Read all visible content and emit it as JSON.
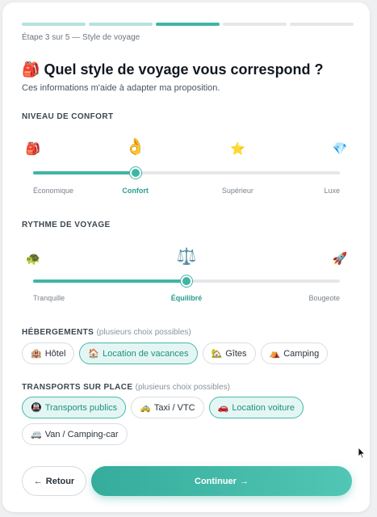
{
  "progress": {
    "current": 3,
    "total": 5
  },
  "step_label": "Étape 3 sur 5 — Style de voyage",
  "title_icon": "🎒",
  "title": "Quel style de voyage vous correspond ?",
  "subtitle": "Ces informations m'aide à adapter ma proposition.",
  "comfort": {
    "title": "NIVEAU DE CONFORT",
    "selected_index": 1,
    "options": [
      {
        "icon": "🎒",
        "label": "Économique"
      },
      {
        "icon": "👌",
        "label": "Confort"
      },
      {
        "icon": "⭐",
        "label": "Supérieur"
      },
      {
        "icon": "💎",
        "label": "Luxe"
      }
    ]
  },
  "rhythm": {
    "title": "RYTHME DE VOYAGE",
    "selected_index": 1,
    "options": [
      {
        "icon": "🐢",
        "label": "Tranquille"
      },
      {
        "icon": "⚖️",
        "label": "Équilibré"
      },
      {
        "icon": "🚀",
        "label": "Bougeote"
      }
    ]
  },
  "accommodations": {
    "title": "HÉBERGEMENTS",
    "hint": "(plusieurs choix possibles)",
    "chips": [
      {
        "icon": "🏨",
        "label": "Hôtel",
        "selected": false
      },
      {
        "icon": "🏠",
        "label": "Location de vacances",
        "selected": true
      },
      {
        "icon": "🏡",
        "label": "Gîtes",
        "selected": false
      },
      {
        "icon": "⛺",
        "label": "Camping",
        "selected": false
      }
    ]
  },
  "transports": {
    "title": "TRANSPORTS SUR PLACE",
    "hint": "(plusieurs choix possibles)",
    "chips": [
      {
        "icon": "🚇",
        "label": "Transports publics",
        "selected": true
      },
      {
        "icon": "🚕",
        "label": "Taxi / VTC",
        "selected": false
      },
      {
        "icon": "🚗",
        "label": "Location voiture",
        "selected": true
      },
      {
        "icon": "🚐",
        "label": "Van / Camping-car",
        "selected": false
      }
    ]
  },
  "buttons": {
    "back_arrow": "←",
    "back_label": "Retour",
    "next_label": "Continuer",
    "next_arrow": "→"
  },
  "colors": {
    "accent": "#3fb5a5",
    "accent_light": "#b6e2dc",
    "chip_selected_bg": "#e4f6f3"
  }
}
